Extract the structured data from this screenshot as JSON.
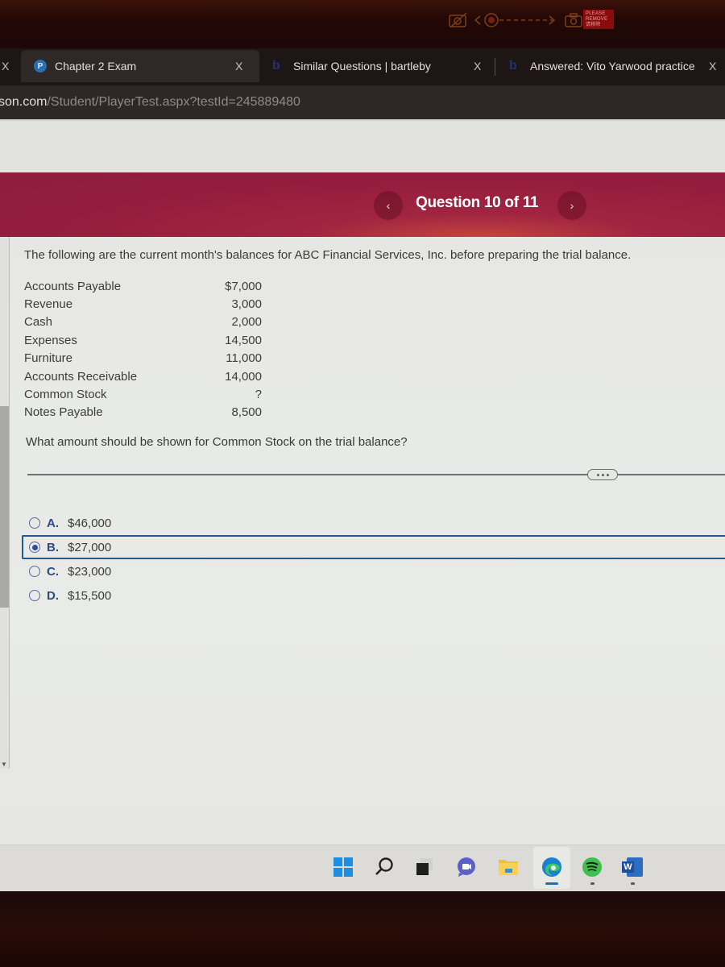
{
  "camera_overlay": {
    "label": "PLEASE REMOVE",
    "sublabel": "请移除"
  },
  "tabs": [
    {
      "label": "Chapter 2 Exam",
      "favicon": "pearson-icon",
      "active": true,
      "close": "X"
    },
    {
      "label": "Similar Questions | bartleby",
      "favicon": "bartleby-icon",
      "active": false,
      "close": "X"
    },
    {
      "label": "Answered: Vito Yarwood practice",
      "favicon": "bartleby-icon",
      "active": false,
      "close": "X"
    }
  ],
  "leading_close": "X",
  "address": {
    "host": "son.com",
    "path": "/Student/PlayerTest.aspx?testId=245889480"
  },
  "nav": {
    "prev_icon": "‹",
    "next_icon": "›",
    "counter": "Question 10 of 11",
    "current": 10,
    "total": 11
  },
  "accent_color": "#951d3d",
  "question": {
    "intro": "The following are the current month's balances for ABC Financial Services, Inc. before preparing the trial balance.",
    "accounts": [
      {
        "name": "Accounts Payable",
        "value": "$7,000"
      },
      {
        "name": "Revenue",
        "value": "3,000"
      },
      {
        "name": "Cash",
        "value": "2,000"
      },
      {
        "name": "Expenses",
        "value": "14,500"
      },
      {
        "name": "Furniture",
        "value": "11,000"
      },
      {
        "name": "Accounts Receivable",
        "value": "14,000"
      },
      {
        "name": "Common Stock",
        "value": "?"
      },
      {
        "name": "Notes Payable",
        "value": "8,500"
      }
    ],
    "prompt": "What amount should be shown for Common Stock on the trial balance?",
    "more_label": "..."
  },
  "options": [
    {
      "letter": "A.",
      "value": "$46,000",
      "selected": false
    },
    {
      "letter": "B.",
      "value": "$27,000",
      "selected": true
    },
    {
      "letter": "C.",
      "value": "$23,000",
      "selected": false
    },
    {
      "letter": "D.",
      "value": "$15,500",
      "selected": false
    }
  ],
  "taskbar": {
    "icons": [
      "windows-start-icon",
      "search-icon",
      "task-view-icon",
      "teams-chat-icon",
      "file-explorer-icon",
      "edge-icon",
      "spotify-icon",
      "word-icon"
    ],
    "active": "edge-icon",
    "word_letter": "W"
  }
}
